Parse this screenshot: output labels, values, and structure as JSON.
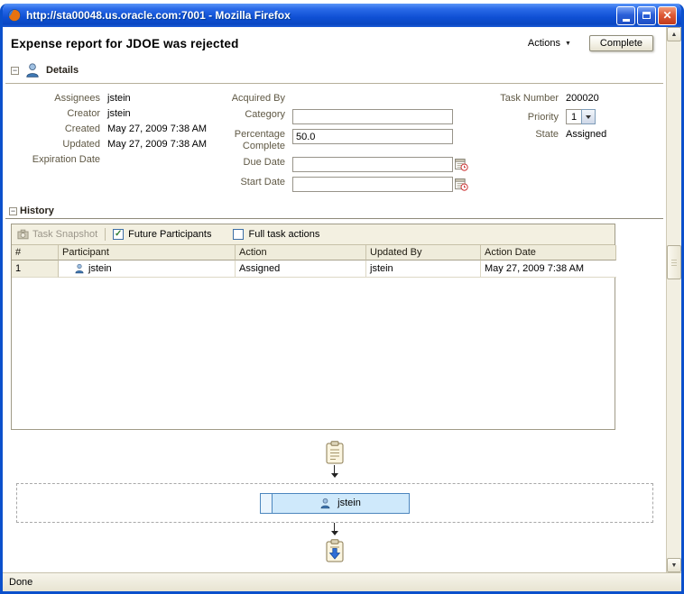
{
  "window": {
    "title": "http://sta00048.us.oracle.com:7001 - Mozilla Firefox",
    "status_text": "Done"
  },
  "icons": {
    "collapse_glyph": "−",
    "close_glyph": "✕",
    "actions_caret": "▼",
    "check_glyph": "✓",
    "scroll_up": "▲",
    "scroll_down": "▼"
  },
  "header": {
    "title": "Expense report for JDOE was rejected",
    "actions_label": "Actions",
    "complete_label": "Complete"
  },
  "details": {
    "section_title": "Details",
    "assignees": {
      "label": "Assignees",
      "value": "jstein"
    },
    "creator": {
      "label": "Creator",
      "value": "jstein"
    },
    "created": {
      "label": "Created",
      "value": "May 27, 2009 7:38 AM"
    },
    "updated": {
      "label": "Updated",
      "value": "May 27, 2009 7:38 AM"
    },
    "expiration": {
      "label": "Expiration Date",
      "value": ""
    },
    "acquired_by": {
      "label": "Acquired By",
      "value": ""
    },
    "category": {
      "label": "Category",
      "value": ""
    },
    "percentage": {
      "label": "Percentage Complete",
      "value": "50.0"
    },
    "due_date": {
      "label": "Due Date",
      "value": ""
    },
    "start_date": {
      "label": "Start Date",
      "value": ""
    },
    "task_number": {
      "label": "Task Number",
      "value": "200020"
    },
    "priority": {
      "label": "Priority",
      "value": "1"
    },
    "state": {
      "label": "State",
      "value": "Assigned"
    }
  },
  "history": {
    "section_title": "History",
    "toolbar": {
      "task_snapshot_label": "Task Snapshot",
      "future_participants_label": "Future Participants",
      "full_task_actions_label": "Full task actions",
      "future_participants_checked": true,
      "full_task_actions_checked": false
    },
    "columns": [
      "#",
      "Participant",
      "Action",
      "Updated By",
      "Action Date"
    ],
    "rows": [
      {
        "num": "1",
        "participant": "jstein",
        "action": "Assigned",
        "updated_by": "jstein",
        "action_date": "May 27, 2009 7:38 AM"
      }
    ]
  },
  "diagram": {
    "participant_label": "jstein"
  }
}
